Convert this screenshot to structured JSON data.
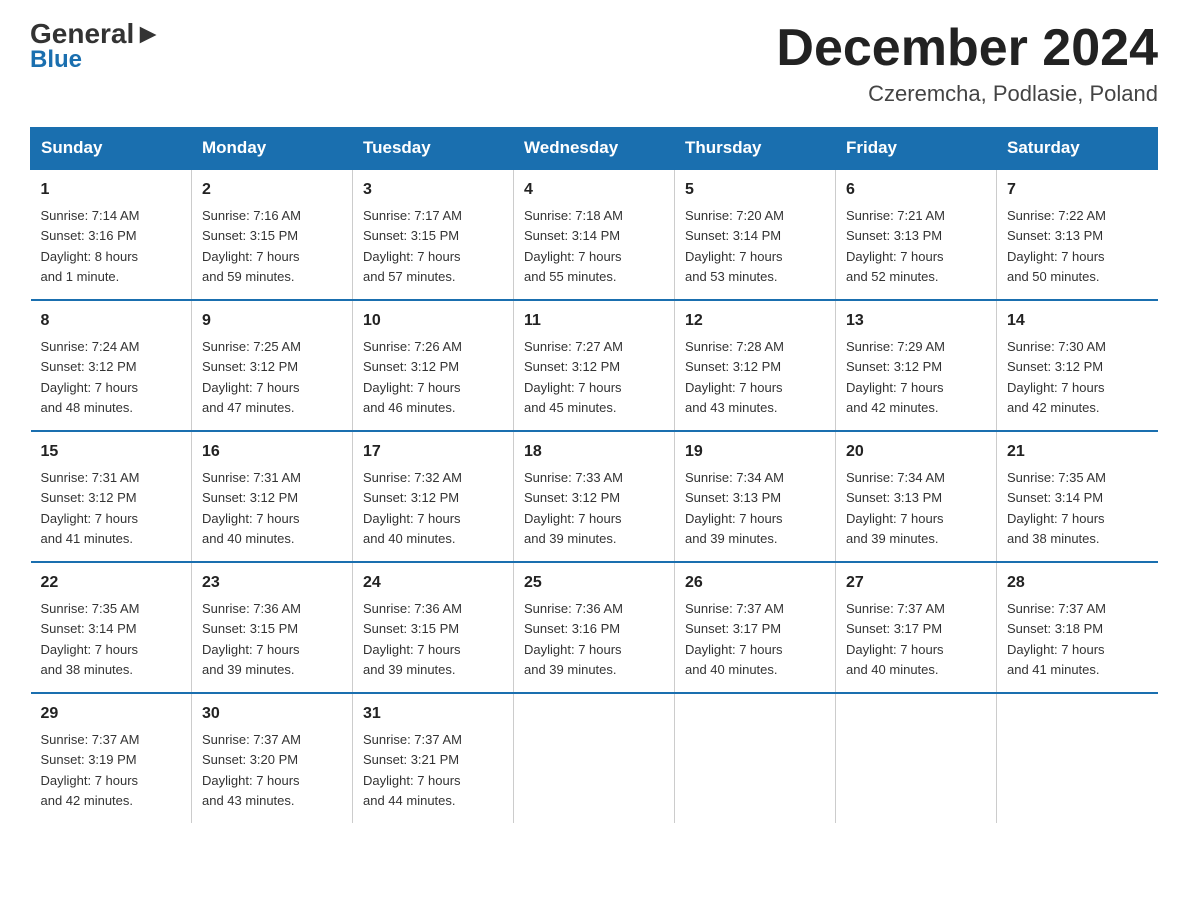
{
  "logo": {
    "line1_part1": "General",
    "line1_arrow": "▶",
    "line2": "Blue"
  },
  "header": {
    "month_year": "December 2024",
    "location": "Czeremcha, Podlasie, Poland"
  },
  "days_of_week": [
    "Sunday",
    "Monday",
    "Tuesday",
    "Wednesday",
    "Thursday",
    "Friday",
    "Saturday"
  ],
  "weeks": [
    [
      {
        "day": "1",
        "sunrise": "7:14 AM",
        "sunset": "3:16 PM",
        "daylight": "8 hours and 1 minute."
      },
      {
        "day": "2",
        "sunrise": "7:16 AM",
        "sunset": "3:15 PM",
        "daylight": "7 hours and 59 minutes."
      },
      {
        "day": "3",
        "sunrise": "7:17 AM",
        "sunset": "3:15 PM",
        "daylight": "7 hours and 57 minutes."
      },
      {
        "day": "4",
        "sunrise": "7:18 AM",
        "sunset": "3:14 PM",
        "daylight": "7 hours and 55 minutes."
      },
      {
        "day": "5",
        "sunrise": "7:20 AM",
        "sunset": "3:14 PM",
        "daylight": "7 hours and 53 minutes."
      },
      {
        "day": "6",
        "sunrise": "7:21 AM",
        "sunset": "3:13 PM",
        "daylight": "7 hours and 52 minutes."
      },
      {
        "day": "7",
        "sunrise": "7:22 AM",
        "sunset": "3:13 PM",
        "daylight": "7 hours and 50 minutes."
      }
    ],
    [
      {
        "day": "8",
        "sunrise": "7:24 AM",
        "sunset": "3:12 PM",
        "daylight": "7 hours and 48 minutes."
      },
      {
        "day": "9",
        "sunrise": "7:25 AM",
        "sunset": "3:12 PM",
        "daylight": "7 hours and 47 minutes."
      },
      {
        "day": "10",
        "sunrise": "7:26 AM",
        "sunset": "3:12 PM",
        "daylight": "7 hours and 46 minutes."
      },
      {
        "day": "11",
        "sunrise": "7:27 AM",
        "sunset": "3:12 PM",
        "daylight": "7 hours and 45 minutes."
      },
      {
        "day": "12",
        "sunrise": "7:28 AM",
        "sunset": "3:12 PM",
        "daylight": "7 hours and 43 minutes."
      },
      {
        "day": "13",
        "sunrise": "7:29 AM",
        "sunset": "3:12 PM",
        "daylight": "7 hours and 42 minutes."
      },
      {
        "day": "14",
        "sunrise": "7:30 AM",
        "sunset": "3:12 PM",
        "daylight": "7 hours and 42 minutes."
      }
    ],
    [
      {
        "day": "15",
        "sunrise": "7:31 AM",
        "sunset": "3:12 PM",
        "daylight": "7 hours and 41 minutes."
      },
      {
        "day": "16",
        "sunrise": "7:31 AM",
        "sunset": "3:12 PM",
        "daylight": "7 hours and 40 minutes."
      },
      {
        "day": "17",
        "sunrise": "7:32 AM",
        "sunset": "3:12 PM",
        "daylight": "7 hours and 40 minutes."
      },
      {
        "day": "18",
        "sunrise": "7:33 AM",
        "sunset": "3:12 PM",
        "daylight": "7 hours and 39 minutes."
      },
      {
        "day": "19",
        "sunrise": "7:34 AM",
        "sunset": "3:13 PM",
        "daylight": "7 hours and 39 minutes."
      },
      {
        "day": "20",
        "sunrise": "7:34 AM",
        "sunset": "3:13 PM",
        "daylight": "7 hours and 39 minutes."
      },
      {
        "day": "21",
        "sunrise": "7:35 AM",
        "sunset": "3:14 PM",
        "daylight": "7 hours and 38 minutes."
      }
    ],
    [
      {
        "day": "22",
        "sunrise": "7:35 AM",
        "sunset": "3:14 PM",
        "daylight": "7 hours and 38 minutes."
      },
      {
        "day": "23",
        "sunrise": "7:36 AM",
        "sunset": "3:15 PM",
        "daylight": "7 hours and 39 minutes."
      },
      {
        "day": "24",
        "sunrise": "7:36 AM",
        "sunset": "3:15 PM",
        "daylight": "7 hours and 39 minutes."
      },
      {
        "day": "25",
        "sunrise": "7:36 AM",
        "sunset": "3:16 PM",
        "daylight": "7 hours and 39 minutes."
      },
      {
        "day": "26",
        "sunrise": "7:37 AM",
        "sunset": "3:17 PM",
        "daylight": "7 hours and 40 minutes."
      },
      {
        "day": "27",
        "sunrise": "7:37 AM",
        "sunset": "3:17 PM",
        "daylight": "7 hours and 40 minutes."
      },
      {
        "day": "28",
        "sunrise": "7:37 AM",
        "sunset": "3:18 PM",
        "daylight": "7 hours and 41 minutes."
      }
    ],
    [
      {
        "day": "29",
        "sunrise": "7:37 AM",
        "sunset": "3:19 PM",
        "daylight": "7 hours and 42 minutes."
      },
      {
        "day": "30",
        "sunrise": "7:37 AM",
        "sunset": "3:20 PM",
        "daylight": "7 hours and 43 minutes."
      },
      {
        "day": "31",
        "sunrise": "7:37 AM",
        "sunset": "3:21 PM",
        "daylight": "7 hours and 44 minutes."
      },
      null,
      null,
      null,
      null
    ]
  ],
  "labels": {
    "sunrise": "Sunrise:",
    "sunset": "Sunset:",
    "daylight": "Daylight:"
  }
}
